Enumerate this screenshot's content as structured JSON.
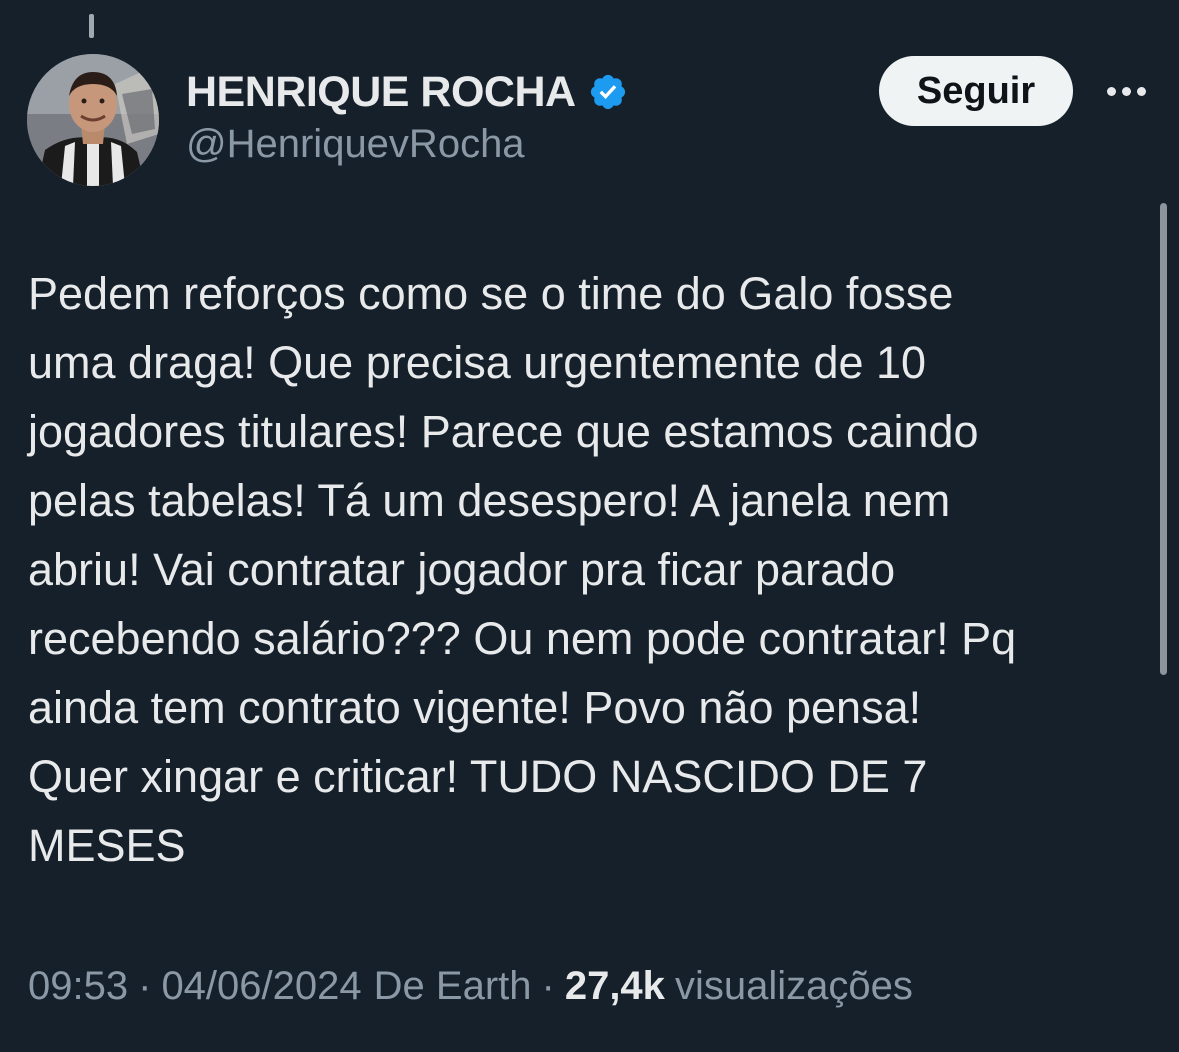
{
  "author": {
    "display_name": "HENRIQUE ROCHA",
    "handle": "@HenriquevRocha",
    "verified": true
  },
  "actions": {
    "follow_label": "Seguir",
    "more_icon": "more-horizontal-icon"
  },
  "tweet": {
    "text_lines": [
      "Pedem reforços como se o time do Galo fosse",
      "uma draga! Que precisa urgentemente de 10",
      "jogadores titulares! Parece que estamos caindo",
      "pelas tabelas! Tá um desespero! A janela nem",
      "abriu! Vai contratar jogador pra ficar parado",
      "recebendo salário??? Ou nem pode contratar! Pq",
      "ainda tem contrato vigente! Povo não pensa!",
      "Quer xingar e criticar! TUDO NASCIDO DE 7",
      "MESES"
    ]
  },
  "meta": {
    "time": "09:53",
    "separator": "·",
    "date": "04/06/2024",
    "source": "De Earth",
    "views_count": "27,4k",
    "views_label": "visualizações"
  },
  "colors": {
    "background": "#15202b",
    "text_primary": "#e7e9ea",
    "text_secondary": "#8b98a5",
    "verified_badge": "#1d9bf0",
    "follow_button_bg": "#eff3f4"
  }
}
